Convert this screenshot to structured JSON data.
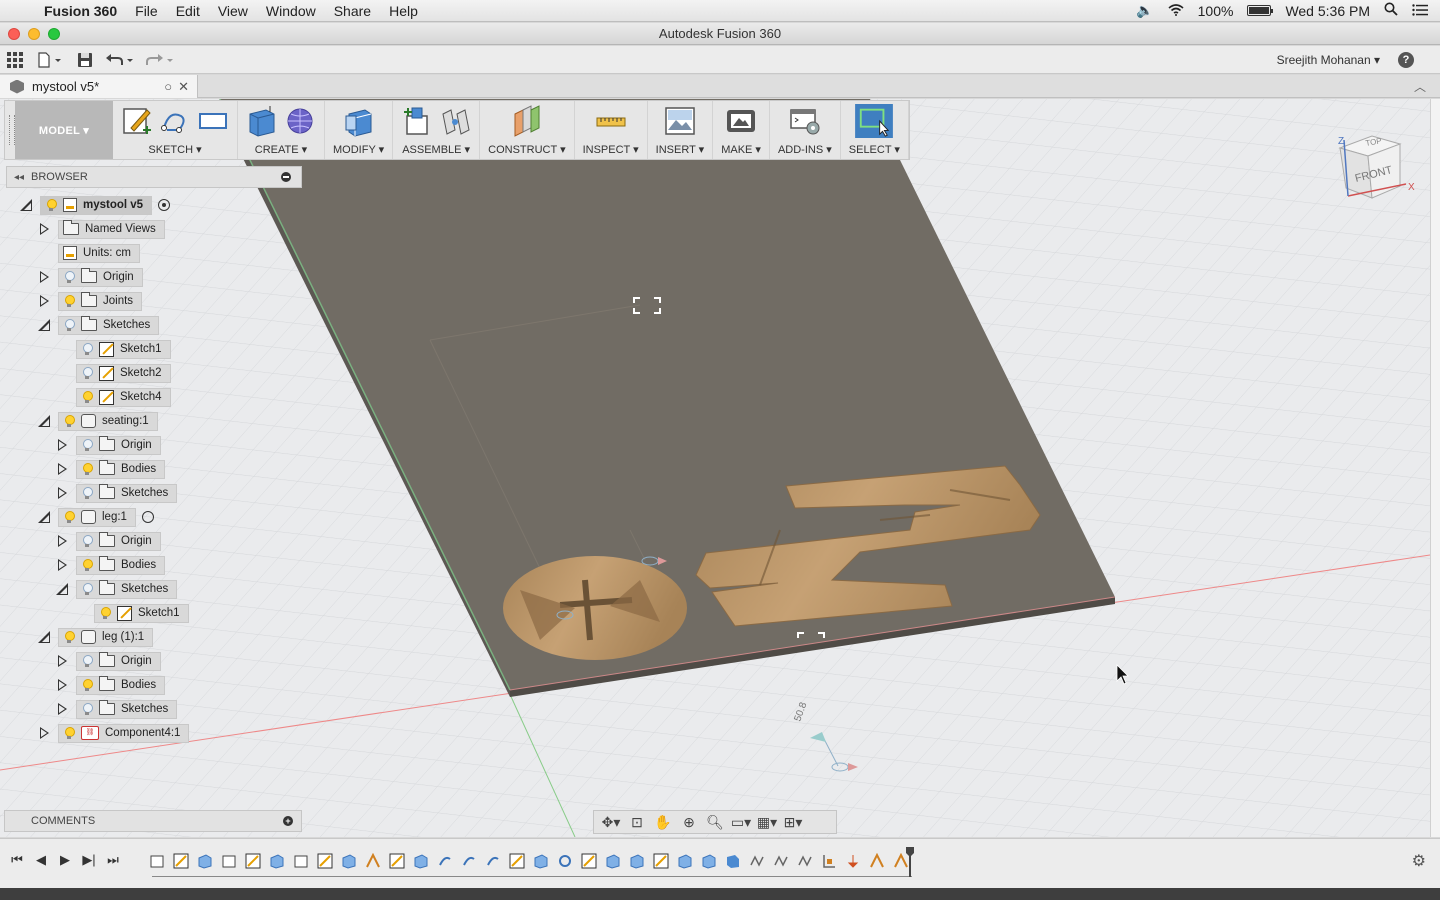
{
  "menubar": {
    "app_name": "Fusion 360",
    "menus": [
      "File",
      "Edit",
      "View",
      "Window",
      "Share",
      "Help"
    ],
    "battery": "100%",
    "clock": "Wed 5:36 PM"
  },
  "window": {
    "title": "Autodesk Fusion 360"
  },
  "quick_access": {
    "user": "Sreejith Mohanan ▾"
  },
  "document_tab": {
    "label": "mystool v5*"
  },
  "ribbon": {
    "workspace": "MODEL ▾",
    "groups": [
      {
        "label": "SKETCH ▾"
      },
      {
        "label": "CREATE ▾"
      },
      {
        "label": "MODIFY ▾"
      },
      {
        "label": "ASSEMBLE ▾"
      },
      {
        "label": "CONSTRUCT ▾"
      },
      {
        "label": "INSPECT ▾"
      },
      {
        "label": "INSERT ▾"
      },
      {
        "label": "MAKE ▾"
      },
      {
        "label": "ADD-INS ▾"
      },
      {
        "label": "SELECT ▾"
      }
    ]
  },
  "browser": {
    "title": "BROWSER",
    "items": [
      {
        "label": "mystool v5"
      },
      {
        "label": "Named Views"
      },
      {
        "label": "Units: cm"
      },
      {
        "label": "Origin"
      },
      {
        "label": "Joints"
      },
      {
        "label": "Sketches"
      },
      {
        "label": "Sketch1"
      },
      {
        "label": "Sketch2"
      },
      {
        "label": "Sketch4"
      },
      {
        "label": "seating:1"
      },
      {
        "label": "Origin"
      },
      {
        "label": "Bodies"
      },
      {
        "label": "Sketches"
      },
      {
        "label": "leg:1"
      },
      {
        "label": "Origin"
      },
      {
        "label": "Bodies"
      },
      {
        "label": "Sketches"
      },
      {
        "label": "Sketch1"
      },
      {
        "label": "leg (1):1"
      },
      {
        "label": "Origin"
      },
      {
        "label": "Bodies"
      },
      {
        "label": "Sketches"
      },
      {
        "label": "Component4:1"
      }
    ]
  },
  "viewcube": {
    "top": "TOP",
    "front": "FRONT",
    "axis_x": "X",
    "axis_z": "Z"
  },
  "comments": {
    "title": "COMMENTS"
  },
  "colors": {
    "board": "#6f6a62",
    "wood": "#b89266",
    "workspace_btn": "#b8b8b8",
    "select_active": "#3f7fc0"
  }
}
